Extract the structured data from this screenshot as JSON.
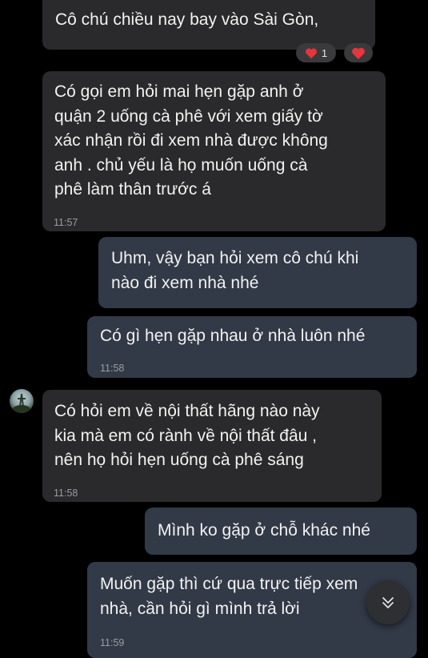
{
  "messages": [
    {
      "text": "Cô chú chiều nay bay vào Sài Gòn,",
      "time": ""
    },
    {
      "text": "Có gọi em hỏi mai hẹn gặp  anh  ở\nquận 2 uống cà phê với xem giấy tờ\nxác nhận rồi đi xem nhà được không\nanh . chủ yếu là họ muốn uống cà\nphê  làm thân trước á",
      "time": "11:57"
    },
    {
      "text": "Uhm, vậy bạn hỏi xem cô chú khi\nnào đi xem nhà nhé",
      "time": ""
    },
    {
      "text": "Có gì hẹn gặp nhau ở nhà luôn nhé",
      "time": "11:58"
    },
    {
      "text": "Có hỏi em về nội thất hãng nào này\nkia mà em có rành về nội thất  đâu ,\nnên họ hỏi hẹn uống cà phê sáng",
      "time": "11:58"
    },
    {
      "text": "Mình ko gặp ở chỗ khác nhé",
      "time": ""
    },
    {
      "text": "Muốn gặp thì cứ qua trực tiếp xem\nnhà, cần hỏi gì mình trả lời",
      "time": "11:59"
    }
  ],
  "reactions": {
    "heart_count": "1",
    "heart_color": "#e8343c"
  },
  "icons": {
    "reaction": "heart-icon",
    "scroll": "chevron-double-down-icon",
    "avatar": "avatar"
  },
  "colors": {
    "background": "#000000",
    "incoming_bubble": "#2a2a2c",
    "outgoing_bubble": "#323a47",
    "text": "#f2f2f2",
    "timestamp": "#9a9ca1"
  }
}
